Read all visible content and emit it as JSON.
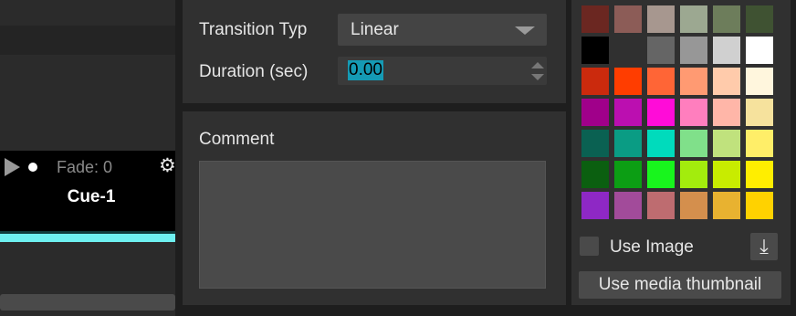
{
  "cue": {
    "fade_text": "Fade: 0",
    "name": "Cue-1",
    "play_icon": "play-icon",
    "gear_icon": "gear-icon",
    "bar_color": "#6ef0f0"
  },
  "transition": {
    "type_label": "Transition Typ",
    "type_value": "Linear",
    "duration_label": "Duration (sec)",
    "duration_value": "0.00"
  },
  "comment": {
    "label": "Comment",
    "value": ""
  },
  "color_grid": {
    "rows": [
      [
        "#6b2721",
        "#8c5c57",
        "#a7978f",
        "#9ca891",
        "#6d7d5b",
        "#3f5232"
      ],
      [
        "#000000",
        "#303030",
        "#656565",
        "#979797",
        "#d0d0d0",
        "#ffffff"
      ],
      [
        "#cb2a0d",
        "#ff3d00",
        "#ff6536",
        "#ff9a72",
        "#ffcbab",
        "#fff6dd"
      ],
      [
        "#a0008a",
        "#bb0fb0",
        "#ff0cd8",
        "#ff7ebe",
        "#ffb6a8",
        "#f6e29d"
      ],
      [
        "#0a6152",
        "#0a9c84",
        "#00dbbc",
        "#80e08a",
        "#c0e27d",
        "#ffee68"
      ],
      [
        "#0b5f10",
        "#0c9e14",
        "#18f51d",
        "#a3ec0d",
        "#c8ec00",
        "#ffee00"
      ],
      [
        "#8e28c5",
        "#a24b9a",
        "#be6c70",
        "#d48f4d",
        "#e8b230",
        "#ffd200"
      ]
    ]
  },
  "image": {
    "use_image_label": "Use Image",
    "use_image_checked": false,
    "download_icon": "download-icon",
    "thumbnail_button_label": "Use media thumbnail"
  }
}
